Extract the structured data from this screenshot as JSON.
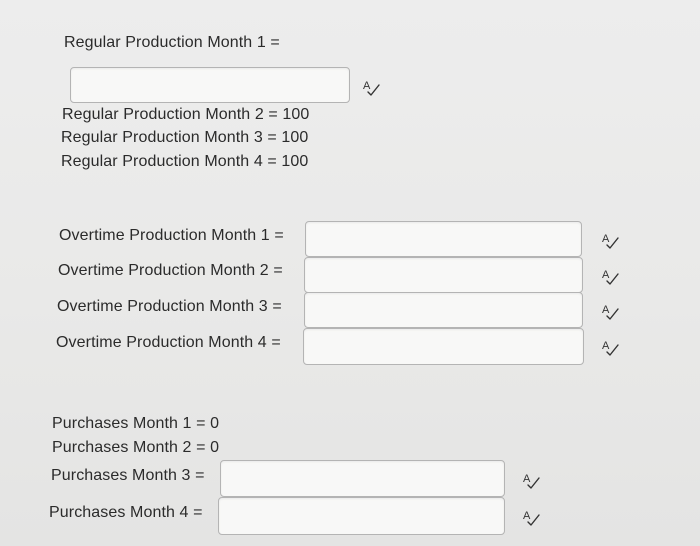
{
  "regular_production": {
    "month1": {
      "label": "Regular Production Month 1 =",
      "value": ""
    },
    "month2": {
      "label": "Regular Production Month 2 = 100"
    },
    "month3": {
      "label": "Regular Production Month 3 = 100"
    },
    "month4": {
      "label": "Regular Production Month 4 = 100"
    }
  },
  "overtime_production": {
    "month1": {
      "label": "Overtime Production Month 1 =",
      "value": ""
    },
    "month2": {
      "label": "Overtime Production Month 2 =",
      "value": ""
    },
    "month3": {
      "label": "Overtime Production Month 3 =",
      "value": ""
    },
    "month4": {
      "label": "Overtime Production Month 4 =",
      "value": ""
    }
  },
  "purchases": {
    "month1": {
      "label": "Purchases Month 1 = 0"
    },
    "month2": {
      "label": "Purchases Month 2 = 0"
    },
    "month3": {
      "label": "Purchases Month 3 =",
      "value": ""
    },
    "month4": {
      "label": "Purchases Month 4 =",
      "value": ""
    }
  },
  "icons": {
    "spellcheck": "spellcheck-icon"
  }
}
